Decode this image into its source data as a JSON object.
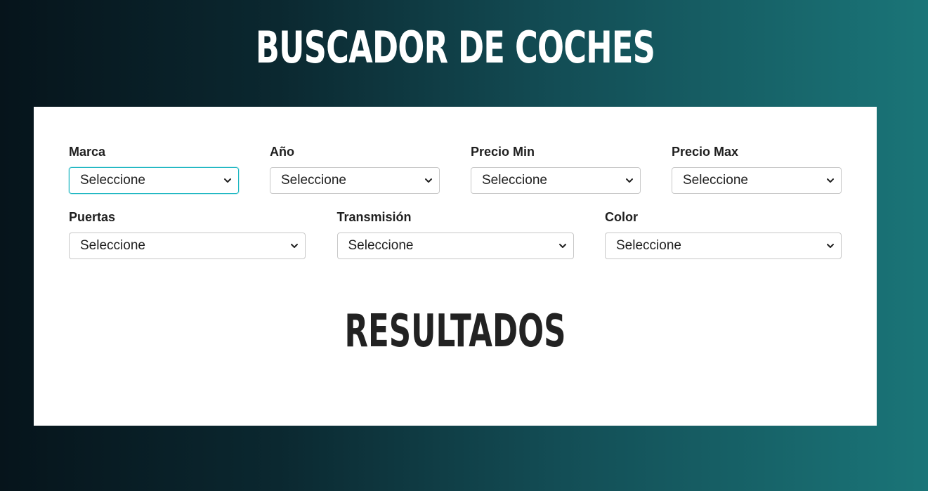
{
  "header": {
    "title": "Buscador de Coches"
  },
  "filters": {
    "marca": {
      "label": "Marca",
      "value": "Seleccione"
    },
    "anio": {
      "label": "Año",
      "value": "Seleccione"
    },
    "precio_min": {
      "label": "Precio Min",
      "value": "Seleccione"
    },
    "precio_max": {
      "label": "Precio Max",
      "value": "Seleccione"
    },
    "puertas": {
      "label": "Puertas",
      "value": "Seleccione"
    },
    "transmision": {
      "label": "Transmisión",
      "value": "Seleccione"
    },
    "color": {
      "label": "Color",
      "value": "Seleccione"
    }
  },
  "results": {
    "title": "Resultados"
  },
  "colors": {
    "gradient_start": "#06141b",
    "gradient_end": "#1a7578",
    "focus_border": "#1fb7c2",
    "panel_bg": "#ffffff"
  },
  "icons": {
    "select_arrow": "chevron-down-icon"
  }
}
